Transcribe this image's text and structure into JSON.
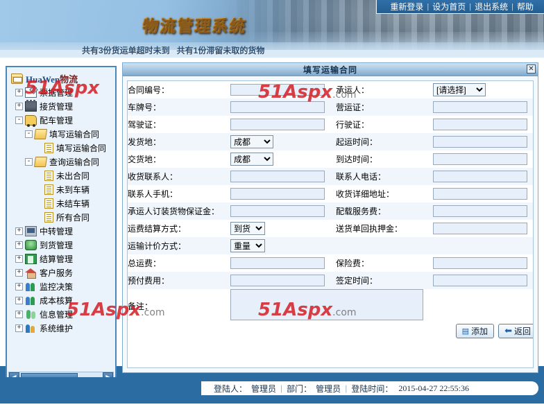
{
  "header": {
    "system_title": "物流管理系统",
    "notice": "共有3份货运单超时未到   共有1份滞留未取的货物",
    "topnav": [
      {
        "label": "重新登录"
      },
      {
        "label": "设为首页"
      },
      {
        "label": "退出系统"
      },
      {
        "label": "帮助"
      }
    ]
  },
  "sidebar": {
    "root": {
      "label_en": "HuaWen",
      "label_cn": "物流",
      "icon": "root-folder-icon"
    },
    "items": [
      {
        "label": "票据管理",
        "icon": "document-edit-icon",
        "toggle": "+",
        "depth": 1
      },
      {
        "label": "接货管理",
        "icon": "factory-icon",
        "toggle": "+",
        "depth": 1
      },
      {
        "label": "配车管理",
        "icon": "truck-icon",
        "toggle": "-",
        "depth": 1
      },
      {
        "label": "填写运输合同",
        "icon": "open-folder-icon",
        "toggle": "-",
        "depth": 2
      },
      {
        "label": "填写运输合同",
        "icon": "note-icon",
        "toggle": "",
        "depth": 3
      },
      {
        "label": "查询运输合同",
        "icon": "open-folder-icon",
        "toggle": "-",
        "depth": 2
      },
      {
        "label": "未出合同",
        "icon": "note-icon",
        "toggle": "",
        "depth": 3
      },
      {
        "label": "未到车辆",
        "icon": "note-icon",
        "toggle": "",
        "depth": 3
      },
      {
        "label": "未结车辆",
        "icon": "note-icon",
        "toggle": "",
        "depth": 3
      },
      {
        "label": "所有合同",
        "icon": "note-icon",
        "toggle": "",
        "depth": 3
      },
      {
        "label": "中转管理",
        "icon": "computer-icon",
        "toggle": "+",
        "depth": 1
      },
      {
        "label": "到货管理",
        "icon": "arrival-icon",
        "toggle": "+",
        "depth": 1
      },
      {
        "label": "结算管理",
        "icon": "book-icon",
        "toggle": "+",
        "depth": 1
      },
      {
        "label": "客户服务",
        "icon": "home-icon",
        "toggle": "+",
        "depth": 1
      },
      {
        "label": "监控决策",
        "icon": "people-icon",
        "toggle": "+",
        "depth": 1
      },
      {
        "label": "成本核算",
        "icon": "people-icon",
        "toggle": "+",
        "depth": 1
      },
      {
        "label": "信息管理",
        "icon": "info-people-icon",
        "toggle": "+",
        "depth": 1
      },
      {
        "label": "系统维护",
        "icon": "maintenance-icon",
        "toggle": "+",
        "depth": 1
      }
    ]
  },
  "dialog": {
    "title": "填写运输合同",
    "close_label": "✕",
    "rows": [
      {
        "left_label": "合同编号：",
        "left_type": "text",
        "left_value": "",
        "right_label": "承运人：",
        "right_type": "select",
        "right_value": "[请选择]",
        "right_options": [
          "[请选择]"
        ]
      },
      {
        "left_label": "车牌号：",
        "left_type": "text",
        "left_value": "",
        "right_label": "营运证：",
        "right_type": "text",
        "right_value": ""
      },
      {
        "left_label": "驾驶证：",
        "left_type": "text",
        "left_value": "",
        "right_label": "行驶证：",
        "right_type": "text",
        "right_value": ""
      },
      {
        "left_label": "发货地：",
        "left_type": "select",
        "left_value": "成都",
        "left_options": [
          "成都"
        ],
        "right_label": "起运时间：",
        "right_type": "text",
        "right_value": ""
      },
      {
        "left_label": "交货地：",
        "left_type": "select",
        "left_value": "成都",
        "left_options": [
          "成都"
        ],
        "right_label": "到达时间：",
        "right_type": "text",
        "right_value": ""
      },
      {
        "left_label": "收货联系人：",
        "left_type": "text",
        "left_value": "",
        "right_label": "联系人电话：",
        "right_type": "text",
        "right_value": ""
      },
      {
        "left_label": "联系人手机：",
        "left_type": "text",
        "left_value": "",
        "right_label": "收货详细地址：",
        "right_type": "text",
        "right_value": ""
      },
      {
        "left_label": "承运人订装货物保证金：",
        "left_type": "text",
        "left_value": "",
        "right_label": "配载服务费：",
        "right_type": "text",
        "right_value": ""
      },
      {
        "left_label": "运费结算方式：",
        "left_type": "select",
        "left_value": "到货",
        "left_options": [
          "到货"
        ],
        "right_label": "送货单回执押金：",
        "right_type": "text",
        "right_value": ""
      },
      {
        "left_label": "运输计价方式：",
        "left_type": "select",
        "left_value": "重量",
        "left_options": [
          "重量"
        ],
        "right_label": "",
        "right_type": "none",
        "right_value": ""
      },
      {
        "left_label": "总运费：",
        "left_type": "text",
        "left_value": "",
        "right_label": "保险费：",
        "right_type": "text",
        "right_value": ""
      },
      {
        "left_label": "预付费用：",
        "left_type": "text",
        "left_value": "",
        "right_label": "签定时间：",
        "right_type": "text",
        "right_value": ""
      }
    ],
    "remark": {
      "label": "备注：",
      "value": ""
    },
    "buttons": [
      {
        "label": "添加",
        "icon": "add-icon",
        "glyph": "▤"
      },
      {
        "label": "返回",
        "icon": "back-icon",
        "glyph": "⬅"
      }
    ]
  },
  "footer": {
    "user_label": "登陆人：",
    "user_value": "管理员",
    "dept_label": "部门：",
    "dept_value": "管理员",
    "time_label": "登陆时间：",
    "time_value": "2015-04-27 22:55:36"
  },
  "watermark": {
    "part1": "51",
    "part2": "Aspx",
    "part3": ".com"
  },
  "colors": {
    "accent": "#2b6ca3",
    "panel_border": "#7fa9cd",
    "field_bg": "#e7f0fa",
    "title_gold": "#ffd270"
  }
}
